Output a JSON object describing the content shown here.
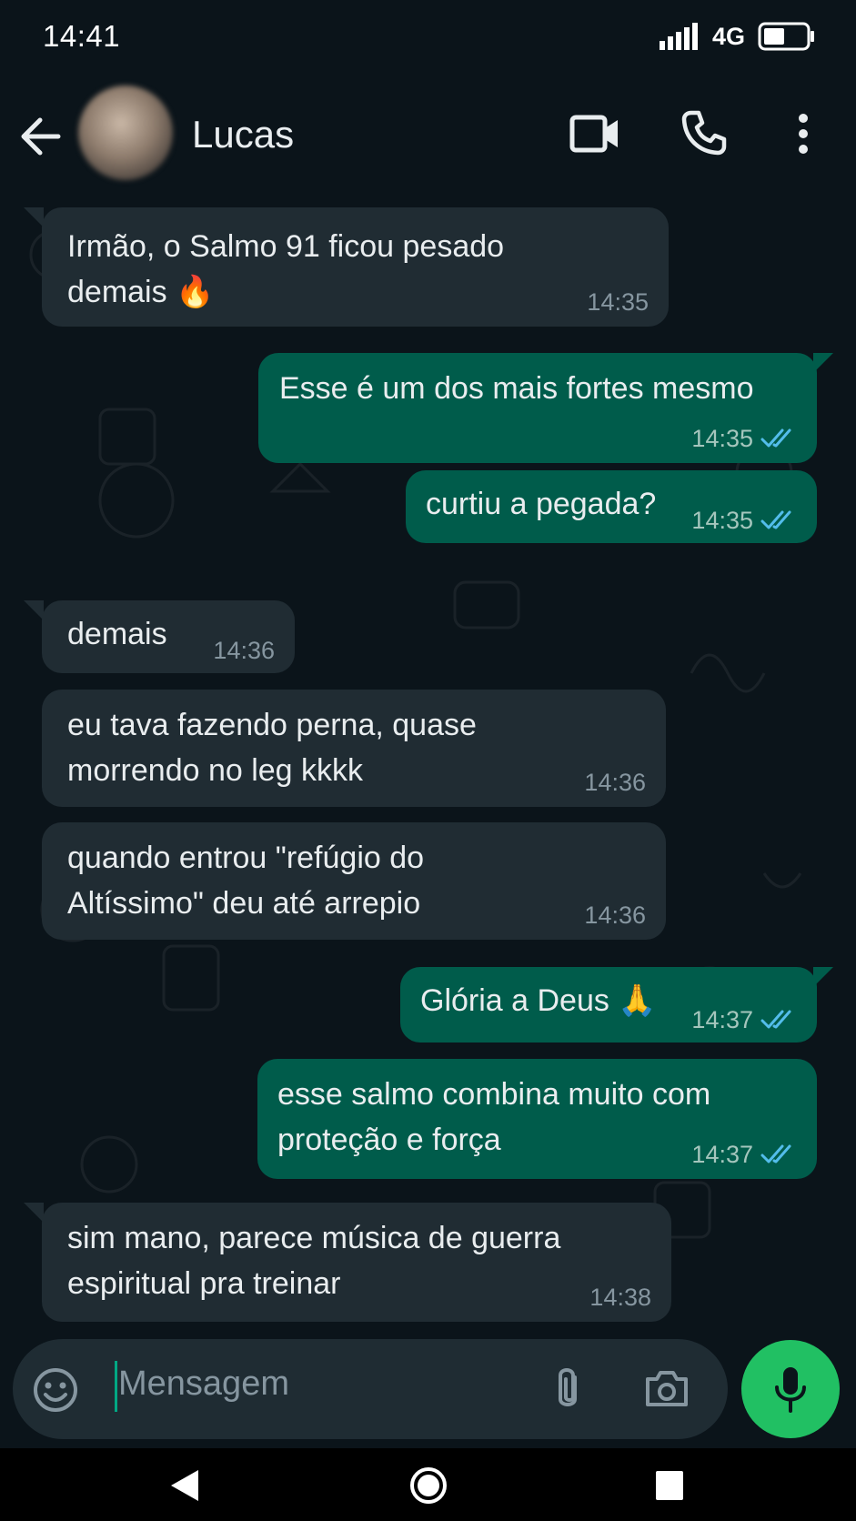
{
  "status_bar": {
    "time": "14:41",
    "network": "4G"
  },
  "header": {
    "contact_name": "Lucas"
  },
  "messages": [
    {
      "dir": "in",
      "lines": [
        "Irmão, o Salmo 91 ficou pesado",
        "demais 🔥"
      ],
      "time": "14:35"
    },
    {
      "dir": "out",
      "lines": [
        "Esse é um dos mais fortes mesmo"
      ],
      "time": "14:35"
    },
    {
      "dir": "out",
      "lines": [
        "curtiu a pegada?"
      ],
      "time": "14:35"
    },
    {
      "dir": "in",
      "lines": [
        "demais"
      ],
      "time": "14:36"
    },
    {
      "dir": "in",
      "lines": [
        "eu tava fazendo perna, quase",
        "morrendo no leg kkkk"
      ],
      "time": "14:36"
    },
    {
      "dir": "in",
      "lines": [
        "quando entrou \"refúgio do",
        "Altíssimo\" deu até arrepio"
      ],
      "time": "14:36"
    },
    {
      "dir": "out",
      "lines": [
        "Glória a Deus 🙏"
      ],
      "time": "14:37"
    },
    {
      "dir": "out",
      "lines": [
        "esse salmo combina muito com",
        "proteção e força"
      ],
      "time": "14:37"
    },
    {
      "dir": "in",
      "lines": [
        "sim mano, parece música de guerra",
        "espiritual pra treinar"
      ],
      "time": "14:38"
    }
  ],
  "composer": {
    "placeholder": "Mensagem"
  },
  "colors": {
    "background": "#0b141a",
    "incoming_bubble": "#202c33",
    "outgoing_bubble": "#005c4b",
    "read_ticks": "#53bdeb",
    "mic_button": "#21c063"
  }
}
